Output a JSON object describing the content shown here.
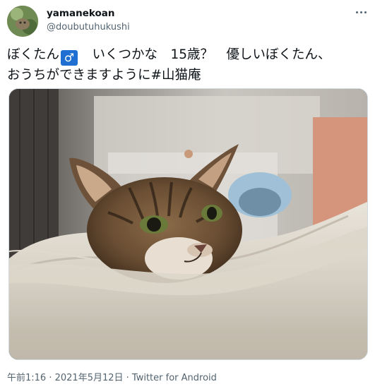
{
  "user": {
    "display_name": "yamanekoan",
    "handle": "@doubutuhukushi",
    "avatar_icon": "avatar"
  },
  "tweet": {
    "line1_a": "ぼくたん",
    "male_symbol": "♂",
    "line1_b": "　いくつかな　15歳？　優しいぼくたん、",
    "line2_a": "おうちができますように",
    "hashtag": "#山猫庵"
  },
  "media": {
    "icon": "cat-photo"
  },
  "meta": {
    "time": "午前1:16",
    "sep1": " · ",
    "date": "2021年5月12日",
    "sep2": " · ",
    "source": "Twitter for Android"
  },
  "colors": {
    "text": "#0f1419",
    "secondary": "#536471",
    "male_badge": "#1e6fd1"
  }
}
